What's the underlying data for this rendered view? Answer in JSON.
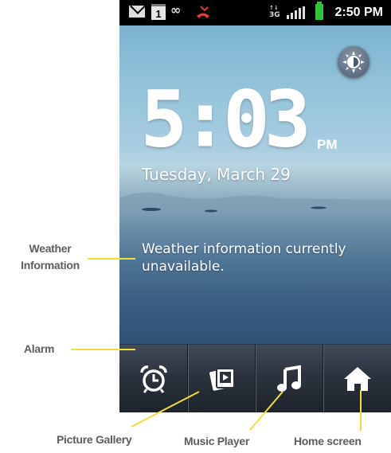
{
  "status_bar": {
    "calendar_day": "1",
    "network": "3G",
    "time": "2:50 PM",
    "icons": [
      "mail-icon",
      "calendar-icon",
      "voicemail-icon",
      "missed-call-icon",
      "data-network-icon",
      "signal-icon",
      "battery-icon"
    ],
    "battery_color": "#31c43a"
  },
  "clock": {
    "time": "5:03",
    "ampm": "PM",
    "date": "Tuesday, March 29"
  },
  "weather": {
    "text": "Weather information currently unavailable."
  },
  "dock": {
    "buttons": [
      {
        "icon": "alarm-clock-icon"
      },
      {
        "icon": "picture-gallery-icon"
      },
      {
        "icon": "music-note-icon"
      },
      {
        "icon": "home-icon"
      }
    ]
  },
  "callouts": {
    "weather_line1": "Weather",
    "weather_line2": "Information",
    "alarm": "Alarm",
    "picture_gallery": "Picture Gallery",
    "music_player": "Music Player",
    "home_screen": "Home screen",
    "line_color": "#f2df3a"
  }
}
